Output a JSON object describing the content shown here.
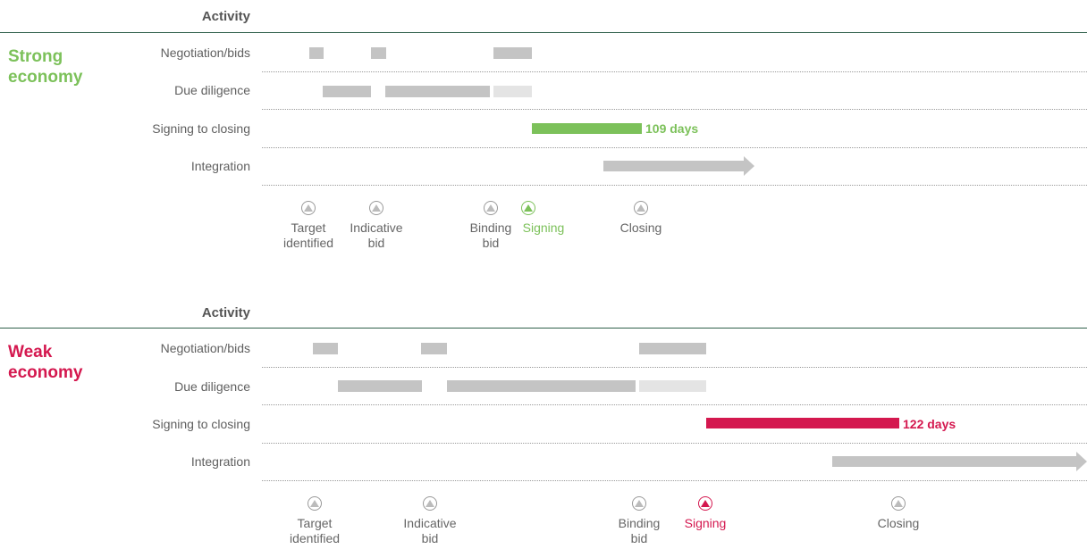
{
  "colors": {
    "strong": "#7cc15a",
    "weak": "#d4184f",
    "bar": "#c4c4c4",
    "bar_light": "#e4e4e4",
    "rule": "#2f5f4a"
  },
  "chart_data": [
    {
      "type": "gantt",
      "scenario": "Strong economy",
      "header": "Activity",
      "rows": [
        {
          "label": "Negotiation/bids"
        },
        {
          "label": "Due diligence"
        },
        {
          "label": "Signing to closing",
          "duration_label": "109 days"
        },
        {
          "label": "Integration"
        }
      ],
      "milestones": [
        {
          "name": "target",
          "line1": "Target",
          "line2": "identified"
        },
        {
          "name": "indicative",
          "line1": "Indicative",
          "line2": "bid"
        },
        {
          "name": "binding",
          "line1": "Binding",
          "line2": "bid"
        },
        {
          "name": "signing",
          "line1": "Signing",
          "line2": ""
        },
        {
          "name": "closing",
          "line1": "Closing",
          "line2": ""
        }
      ]
    },
    {
      "type": "gantt",
      "scenario": "Weak economy",
      "header": "Activity",
      "rows": [
        {
          "label": "Negotiation/bids"
        },
        {
          "label": "Due diligence"
        },
        {
          "label": "Signing to closing",
          "duration_label": "122 days"
        },
        {
          "label": "Integration"
        }
      ],
      "milestones": [
        {
          "name": "target",
          "line1": "Target",
          "line2": "identified"
        },
        {
          "name": "indicative",
          "line1": "Indicative",
          "line2": "bid"
        },
        {
          "name": "binding",
          "line1": "Binding",
          "line2": "bid"
        },
        {
          "name": "signing",
          "line1": "Signing",
          "line2": ""
        },
        {
          "name": "closing",
          "line1": "Closing",
          "line2": ""
        }
      ]
    }
  ],
  "strong": {
    "title_line1": "Strong",
    "title_line2": "economy"
  },
  "weak": {
    "title_line1": "Weak",
    "title_line2": "economy"
  }
}
